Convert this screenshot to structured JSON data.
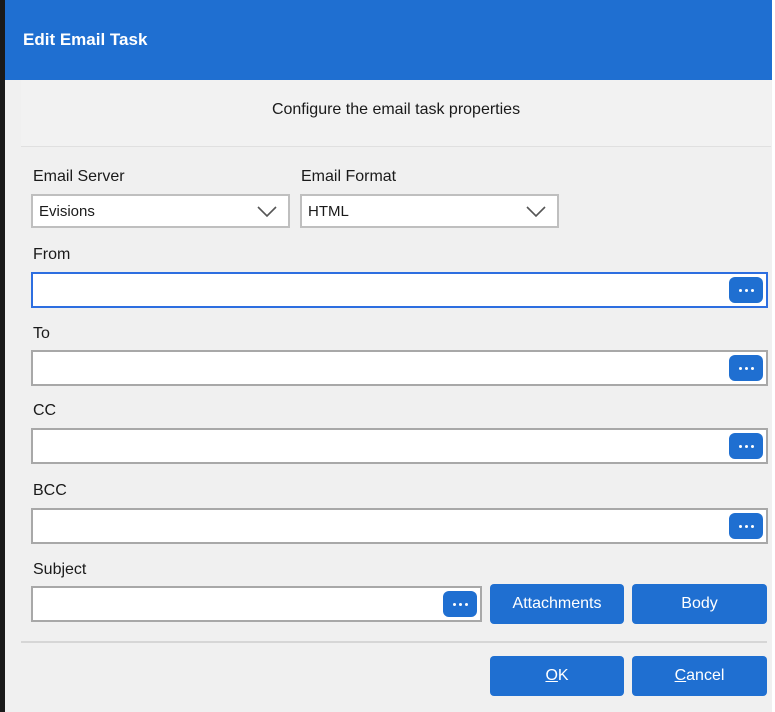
{
  "window": {
    "title": "Edit Email Task"
  },
  "banner": {
    "text": "Configure the email task properties"
  },
  "form": {
    "email_server": {
      "label": "Email Server",
      "value": "Evisions"
    },
    "email_format": {
      "label": "Email Format",
      "value": "HTML"
    },
    "from": {
      "label": "From",
      "value": ""
    },
    "to": {
      "label": "To",
      "value": ""
    },
    "cc": {
      "label": "CC",
      "value": ""
    },
    "bcc": {
      "label": "BCC",
      "value": ""
    },
    "subject": {
      "label": "Subject",
      "value": ""
    }
  },
  "buttons": {
    "attachments": "Attachments",
    "body": "Body",
    "ok_accel": "O",
    "ok_rest": "K",
    "cancel_accel": "C",
    "cancel_rest": "ancel"
  },
  "icons": {
    "browse": "ellipsis-icon",
    "dropdown": "chevron-down-icon"
  },
  "colors": {
    "accent": "#1f6fd1",
    "focus_border": "#2d6ee0"
  }
}
